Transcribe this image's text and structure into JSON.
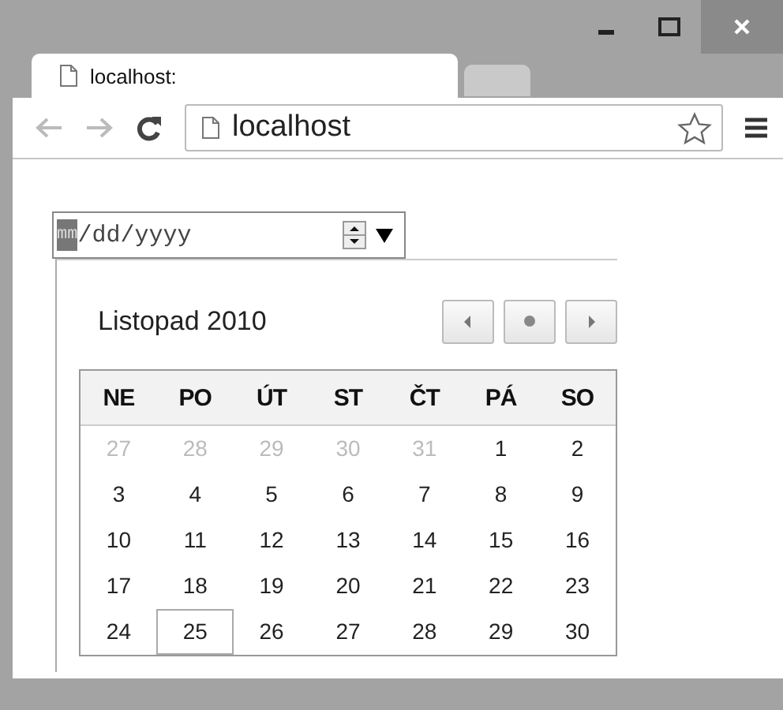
{
  "tabs": [
    {
      "label": "localhost:",
      "selected": true
    },
    {
      "selected": false
    }
  ],
  "toolbar": {
    "address": "localhost"
  },
  "date_input": {
    "month": "mm",
    "day": "dd",
    "year": "yyyy",
    "separator": "/"
  },
  "calendar": {
    "title": "Listopad 2010",
    "weekdays": [
      "NE",
      "PO",
      "ÚT",
      "ST",
      "ČT",
      "PÁ",
      "SO"
    ],
    "weeks": [
      [
        {
          "day": "27",
          "muted": true,
          "selected": false
        },
        {
          "day": "28",
          "muted": true,
          "selected": false
        },
        {
          "day": "29",
          "muted": true,
          "selected": false
        },
        {
          "day": "30",
          "muted": true,
          "selected": false
        },
        {
          "day": "31",
          "muted": true,
          "selected": false
        },
        {
          "day": "1",
          "muted": false,
          "selected": false
        },
        {
          "day": "2",
          "muted": false,
          "selected": false
        }
      ],
      [
        {
          "day": "3",
          "muted": false,
          "selected": false
        },
        {
          "day": "4",
          "muted": false,
          "selected": false
        },
        {
          "day": "5",
          "muted": false,
          "selected": false
        },
        {
          "day": "6",
          "muted": false,
          "selected": false
        },
        {
          "day": "7",
          "muted": false,
          "selected": false
        },
        {
          "day": "8",
          "muted": false,
          "selected": false
        },
        {
          "day": "9",
          "muted": false,
          "selected": false
        }
      ],
      [
        {
          "day": "10",
          "muted": false,
          "selected": false
        },
        {
          "day": "11",
          "muted": false,
          "selected": false
        },
        {
          "day": "12",
          "muted": false,
          "selected": false
        },
        {
          "day": "13",
          "muted": false,
          "selected": false
        },
        {
          "day": "14",
          "muted": false,
          "selected": false
        },
        {
          "day": "15",
          "muted": false,
          "selected": false
        },
        {
          "day": "16",
          "muted": false,
          "selected": false
        }
      ],
      [
        {
          "day": "17",
          "muted": false,
          "selected": false
        },
        {
          "day": "18",
          "muted": false,
          "selected": false
        },
        {
          "day": "19",
          "muted": false,
          "selected": false
        },
        {
          "day": "20",
          "muted": false,
          "selected": false
        },
        {
          "day": "21",
          "muted": false,
          "selected": false
        },
        {
          "day": "22",
          "muted": false,
          "selected": false
        },
        {
          "day": "23",
          "muted": false,
          "selected": false
        }
      ],
      [
        {
          "day": "24",
          "muted": false,
          "selected": false
        },
        {
          "day": "25",
          "muted": false,
          "selected": true
        },
        {
          "day": "26",
          "muted": false,
          "selected": false
        },
        {
          "day": "27",
          "muted": false,
          "selected": false
        },
        {
          "day": "28",
          "muted": false,
          "selected": false
        },
        {
          "day": "29",
          "muted": false,
          "selected": false
        },
        {
          "day": "30",
          "muted": false,
          "selected": false
        }
      ]
    ]
  }
}
